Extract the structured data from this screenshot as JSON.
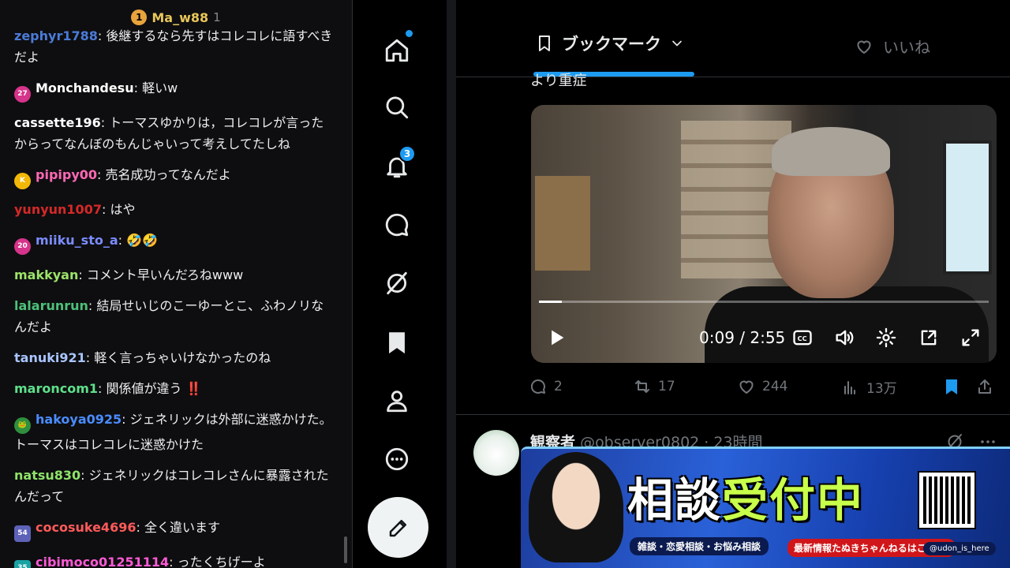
{
  "chat": {
    "header": {
      "badge": "1",
      "name": "Ma_w88",
      "count": "1"
    },
    "messages": [
      {
        "user": "zephyr1788",
        "text": "後継するなら先すはコレコレに語すべきだよ",
        "color": "#4b7bd8",
        "icon": ""
      },
      {
        "user": "Monchandesu",
        "text": "軽いw",
        "color": "#ffffff",
        "icon": "27",
        "icon_color": "#d6338a"
      },
      {
        "user": "cassette196",
        "text": "トーマスゆかりは，コレコレが言ったからってなんぼのもんじゃいって考えしてたしね",
        "color": "#ffffff",
        "icon": ""
      },
      {
        "user": "pipipy00",
        "text": "売名成功ってなんだよ",
        "color": "#ff69b4",
        "icon": "K",
        "icon_color": "#f2b807"
      },
      {
        "user": "yunyun1007",
        "text": "はや",
        "color": "#d62828",
        "icon": ""
      },
      {
        "user": "miiku_sto_a",
        "text": "🤣🤣",
        "color": "#7b8cff",
        "icon": "20",
        "icon_color": "#d6338a"
      },
      {
        "user": "makkyan",
        "text": "コメント早いんだろねwww",
        "color": "#9de36a",
        "icon": ""
      },
      {
        "user": "lalarunrun",
        "text": "結局せいじのこーゆーとこ、ふわノリなんだよ",
        "color": "#4ec07a",
        "icon": ""
      },
      {
        "user": "tanuki921",
        "text": "軽く言っちゃいけなかったのね",
        "color": "#a9c5ff",
        "icon": ""
      },
      {
        "user": "maroncom1",
        "text": "関係値が違う ‼️",
        "color": "#5fe08a",
        "icon": ""
      },
      {
        "user": "hakoya0925",
        "text": "ジェネリックは外部に迷惑かけた。トーマスはコレコレに迷惑かけた",
        "color": "#4a8cff",
        "icon": "🐸",
        "icon_color": "#2f8f3e"
      },
      {
        "user": "natsu830",
        "text": "ジェネリックはコレコレさんに暴露されたんだって",
        "color": "#8fe36a",
        "icon": ""
      },
      {
        "user": "cocosuke4696",
        "text": "全く違います",
        "color": "#ff5a5a",
        "icon": "54",
        "icon_color": "#5d62b8"
      },
      {
        "user": "cibimoco01251114",
        "text": "ったくちげーよ",
        "color": "#ff5ad6",
        "icon": "35",
        "icon_color": "#1aa3a3"
      }
    ]
  },
  "nav": {
    "items": [
      "home",
      "search",
      "notifications",
      "messages",
      "grok",
      "bookmarks",
      "profile",
      "more"
    ],
    "notifications_badge": "3"
  },
  "main": {
    "tab_bookmarks": "ブックマーク",
    "tab_likes": "いいね",
    "cut_text": "より重症",
    "video": {
      "time": "0:09 / 2:55",
      "progress": 0.05
    },
    "actions": {
      "replies": "2",
      "reposts": "17",
      "likes": "244",
      "views": "13万"
    },
    "post2": {
      "display_name": "観察者",
      "handle": "@observer0802",
      "time": "· 23時間"
    }
  },
  "banner": {
    "title_left": "相談",
    "title_right": "受付中",
    "subtitle": "雑談・恋愛相談・お悩み相談",
    "news": "最新情報たぬきちゃんねるはこちら!",
    "x_handle": "@udon_is_here"
  }
}
